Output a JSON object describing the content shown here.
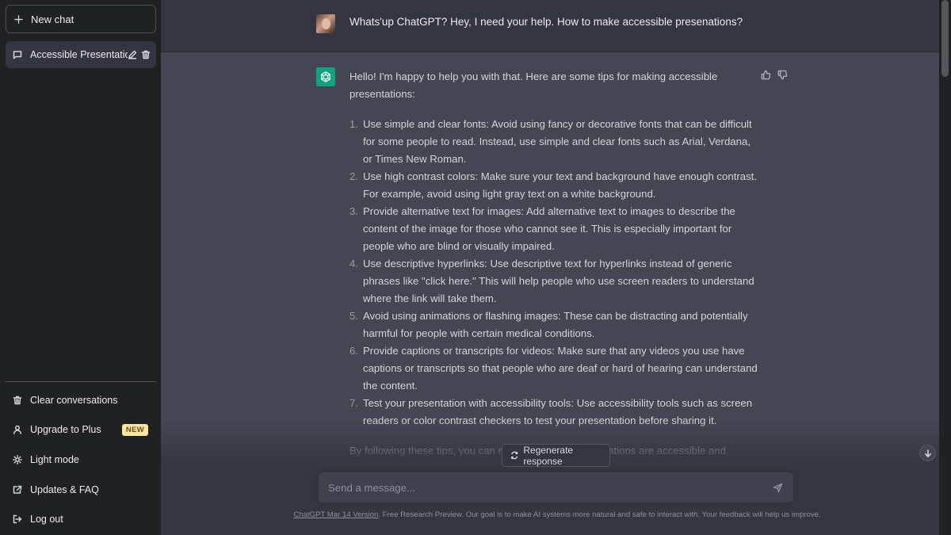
{
  "sidebar": {
    "new_chat_label": "New chat",
    "conversations": [
      {
        "label": "Accessible Presentation"
      }
    ],
    "menu": [
      {
        "label": "Clear conversations",
        "icon": "trash-icon"
      },
      {
        "label": "Upgrade to Plus",
        "icon": "user-icon",
        "badge": "NEW"
      },
      {
        "label": "Light mode",
        "icon": "sun-icon"
      },
      {
        "label": "Updates & FAQ",
        "icon": "external-link-icon"
      },
      {
        "label": "Log out",
        "icon": "logout-icon"
      }
    ]
  },
  "chat": {
    "user_message": "Whats'up ChatGPT? Hey, I need your help. How to make accessible presenations?",
    "assistant": {
      "intro": "Hello! I'm happy to help you with that. Here are some tips for making accessible presentations:",
      "items": [
        {
          "n": "1.",
          "text": "Use simple and clear fonts: Avoid using fancy or decorative fonts that can be difficult for some people to read. Instead, use simple and clear fonts such as Arial, Verdana, or Times New Roman."
        },
        {
          "n": "2.",
          "text": "Use high contrast colors: Make sure your text and background have enough contrast. For example, avoid using light gray text on a white background."
        },
        {
          "n": "3.",
          "text": "Provide alternative text for images: Add alternative text to images to describe the content of the image for those who cannot see it. This is especially important for people who are blind or visually impaired."
        },
        {
          "n": "4.",
          "text": "Use descriptive hyperlinks: Use descriptive text for hyperlinks instead of generic phrases like \"click here.\" This will help people who use screen readers to understand where the link will take them."
        },
        {
          "n": "5.",
          "text": "Avoid using animations or flashing images: These can be distracting and potentially harmful for people with certain medical conditions."
        },
        {
          "n": "6.",
          "text": "Provide captions or transcripts for videos: Make sure that any videos you use have captions or transcripts so that people who are deaf or hard of hearing can understand the content."
        },
        {
          "n": "7.",
          "text": "Test your presentation with accessibility tools: Use accessibility tools such as screen readers or color contrast checkers to test your presentation before sharing it."
        }
      ],
      "outro": "By following these tips, you can make sure your presentations are accessible and inclusive for everyone."
    }
  },
  "regenerate_label": "Regenerate response",
  "input": {
    "placeholder": "Send a message..."
  },
  "footer": {
    "link": "ChatGPT Mar 14 Version",
    "text": ". Free Research Preview. Our goal is to make AI systems more natural and safe to interact with. Your feedback will help us improve."
  },
  "colors": {
    "sidebar_bg": "#202123",
    "user_row_bg": "#343541",
    "assistant_row_bg": "#444654",
    "gpt_logo_bg": "#10a37f",
    "badge_bg": "#fae69e"
  }
}
